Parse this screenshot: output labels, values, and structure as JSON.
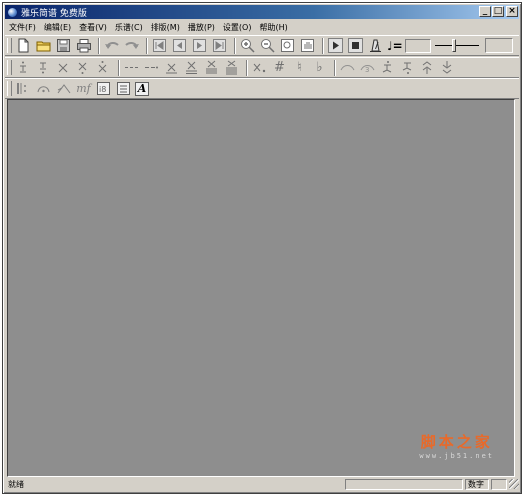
{
  "window": {
    "title": "雅乐简谱 免费版",
    "minimize_label": "_",
    "maximize_label": "□",
    "close_label": "×"
  },
  "menu": [
    {
      "label": "文件(F)"
    },
    {
      "label": "编辑(E)"
    },
    {
      "label": "查看(V)"
    },
    {
      "label": "乐谱(C)"
    },
    {
      "label": "排版(M)"
    },
    {
      "label": "播放(P)"
    },
    {
      "label": "设置(O)"
    },
    {
      "label": "帮助(H)"
    }
  ],
  "toolbar1": {
    "tempo_prefix": "♩="
  },
  "toolbar2": {
    "accidentals": [
      "#",
      "♮",
      "♭"
    ]
  },
  "toolbar3": {
    "dynamic_label": "mf",
    "text_tool_label": "A"
  },
  "watermark": {
    "title": "脚本之家",
    "url": "www.jb51.net"
  },
  "statusbar": {
    "status_text": "就绪",
    "num_indicator": "数字"
  }
}
